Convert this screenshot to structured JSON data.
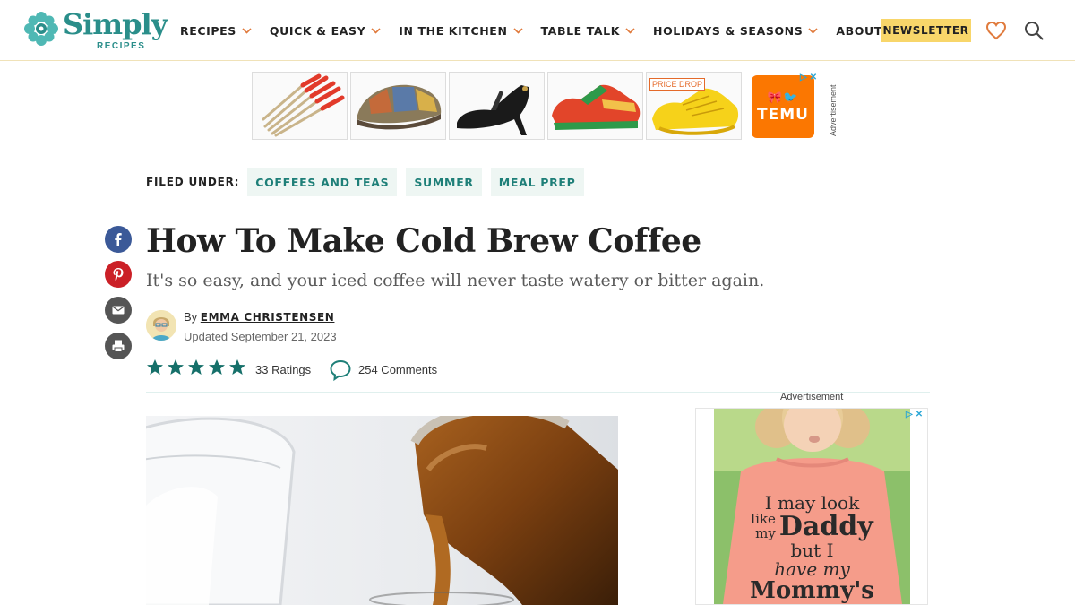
{
  "logo": {
    "word": "Simply",
    "sub": "RECIPES"
  },
  "nav": {
    "items": [
      {
        "label": "RECIPES",
        "dropdown": true
      },
      {
        "label": "QUICK & EASY",
        "dropdown": true
      },
      {
        "label": "IN THE KITCHEN",
        "dropdown": true
      },
      {
        "label": "TABLE TALK",
        "dropdown": true
      },
      {
        "label": "HOLIDAYS & SEASONS",
        "dropdown": true
      },
      {
        "label": "ABOUT US",
        "dropdown": false
      }
    ],
    "newsletter_label": "NEWSLETTER"
  },
  "top_ad": {
    "price_drop": "PRICE DROP",
    "brand": "TEMU",
    "label": "Advertisement"
  },
  "filed_under": {
    "label": "FILED UNDER:",
    "tags": [
      "COFFEES AND TEAS",
      "SUMMER",
      "MEAL PREP"
    ]
  },
  "article": {
    "title": "How To Make Cold Brew Coffee",
    "subtitle": "It's so easy, and your iced coffee will never taste watery or bitter again.",
    "by": "By",
    "author": "EMMA CHRISTENSEN",
    "updated": "Updated September 21, 2023",
    "rating": 5,
    "ratings_label": "33 Ratings",
    "comments_label": "254 Comments"
  },
  "side_ad": {
    "label": "Advertisement",
    "shirt_text": [
      "I may look",
      "like",
      "my",
      "Daddy",
      "but I",
      "have my",
      "Mommy's"
    ]
  },
  "colors": {
    "brand_teal": "#2a8e8a",
    "star_teal": "#16706a",
    "newsletter_bg": "#f8d66a",
    "heart": "#e07a3c",
    "facebook": "#3b5998",
    "pinterest": "#cb2027",
    "share_grey": "#555555",
    "temu": "#fb7701"
  },
  "icons": [
    "flower-logo-icon",
    "chevron-down-icon",
    "heart-icon",
    "search-icon",
    "facebook-icon",
    "pinterest-icon",
    "email-icon",
    "print-icon",
    "star-icon",
    "comment-icon",
    "adchoices-icon",
    "close-icon"
  ]
}
